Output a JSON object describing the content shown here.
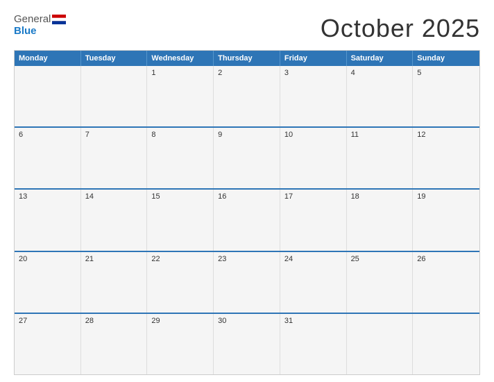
{
  "header": {
    "logo": {
      "general": "General",
      "blue": "Blue",
      "flag_colors": [
        "#cc0000",
        "#ffffff",
        "#0000cc"
      ]
    },
    "title": "October 2025"
  },
  "calendar": {
    "days_of_week": [
      "Monday",
      "Tuesday",
      "Wednesday",
      "Thursday",
      "Friday",
      "Saturday",
      "Sunday"
    ],
    "weeks": [
      [
        null,
        null,
        1,
        2,
        3,
        4,
        5
      ],
      [
        6,
        7,
        8,
        9,
        10,
        11,
        12
      ],
      [
        13,
        14,
        15,
        16,
        17,
        18,
        19
      ],
      [
        20,
        21,
        22,
        23,
        24,
        25,
        26
      ],
      [
        27,
        28,
        29,
        30,
        31,
        null,
        null
      ]
    ]
  }
}
